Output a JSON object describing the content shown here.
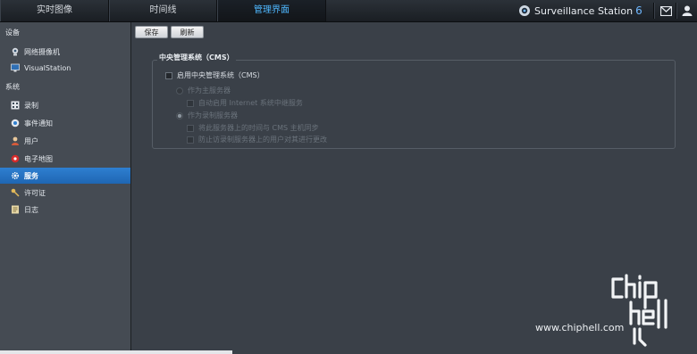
{
  "top_tabs": [
    {
      "label": "实时图像"
    },
    {
      "label": "时间线"
    },
    {
      "label": "管理界面"
    }
  ],
  "brand": {
    "name": "Surveillance Station",
    "version": "6"
  },
  "sidebar": {
    "section_devices": "设备",
    "section_system": "系统",
    "items": [
      {
        "label": "网络摄像机",
        "icon": "camera-icon"
      },
      {
        "label": "VisualStation",
        "icon": "monitor-icon"
      },
      {
        "label": "录制",
        "icon": "recording-icon"
      },
      {
        "label": "事件通知",
        "icon": "notification-icon"
      },
      {
        "label": "用户",
        "icon": "user-icon"
      },
      {
        "label": "电子地图",
        "icon": "map-icon"
      },
      {
        "label": "服务",
        "icon": "gear-icon",
        "active": true
      },
      {
        "label": "许可证",
        "icon": "key-icon"
      },
      {
        "label": "日志",
        "icon": "log-icon"
      }
    ]
  },
  "toolbar": {
    "save_label": "保存",
    "refresh_label": "刷新"
  },
  "cms": {
    "legend": "中央管理系统（CMS）",
    "enable_label": "启用中央管理系统（CMS）",
    "host_server_label": "作为主服务器",
    "auto_internet_label": "自动启用 Internet 系统中继服务",
    "recording_server_label": "作为录制服务器",
    "sync_time_label": "将此服务器上的时间与 CMS 主机同步",
    "block_users_label": "防止访录制服务器上的用户对其进行更改"
  },
  "watermark": {
    "url": "www.chiphell.com"
  },
  "colors": {
    "accent": "#4fb8ff",
    "active_item": "#2673c2",
    "background": "#3a4048",
    "sidebar": "#454b53"
  }
}
